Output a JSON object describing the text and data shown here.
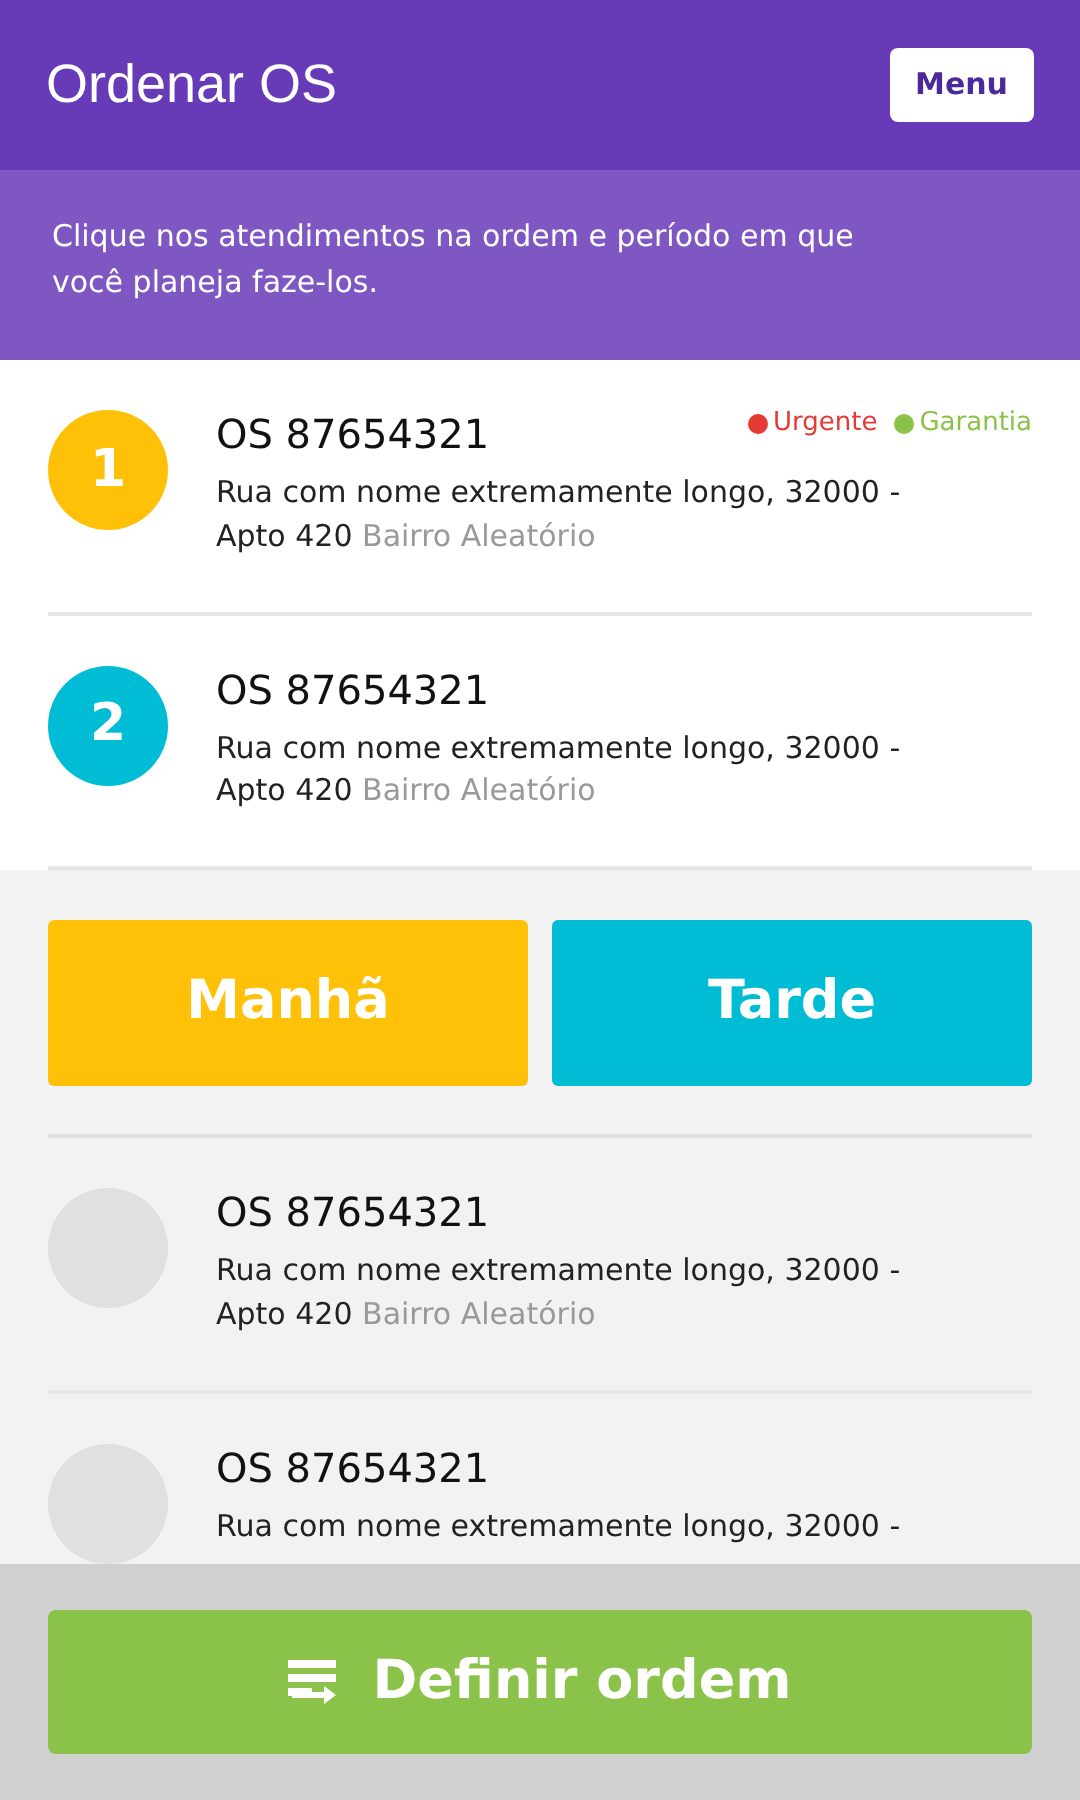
{
  "header": {
    "title": "Ordenar OS",
    "menu_button": "Menu"
  },
  "instruction": "Clique nos atendimentos na ordem e período em que você planeja faze-los.",
  "scheduled": [
    {
      "number": "1",
      "color": "#ffc107",
      "title": "OS 87654321",
      "address_lines": [
        "Rua com nome extremamente longo, 32000 -",
        "Apto 420"
      ],
      "neighborhood": "Bairro Aleatório",
      "tags": [
        {
          "label": "Urgente",
          "color": "#e53935"
        },
        {
          "label": "Garantia",
          "color": "#8bc34a"
        }
      ]
    },
    {
      "number": "2",
      "color": "#00bcd4",
      "title": "OS 87654321",
      "address_lines": [
        "Rua com nome extremamente longo, 32000 -",
        "Apto 420"
      ],
      "neighborhood": "Bairro Aleatório"
    }
  ],
  "periods": [
    {
      "label": "Manhã",
      "color": "#ffc107"
    },
    {
      "label": "Tarde",
      "color": "#00bcd4"
    }
  ],
  "unscheduled": [
    {
      "title": "OS 87654321",
      "address_lines": [
        "Rua com nome extremamente longo, 32000 -",
        "Apto 420"
      ],
      "neighborhood": "Bairro Aleatório"
    },
    {
      "title": "OS 87654321",
      "address_lines": [
        "Rua com nome extremamente longo, 32000 -"
      ]
    }
  ],
  "footer_button": "Definir ordem"
}
